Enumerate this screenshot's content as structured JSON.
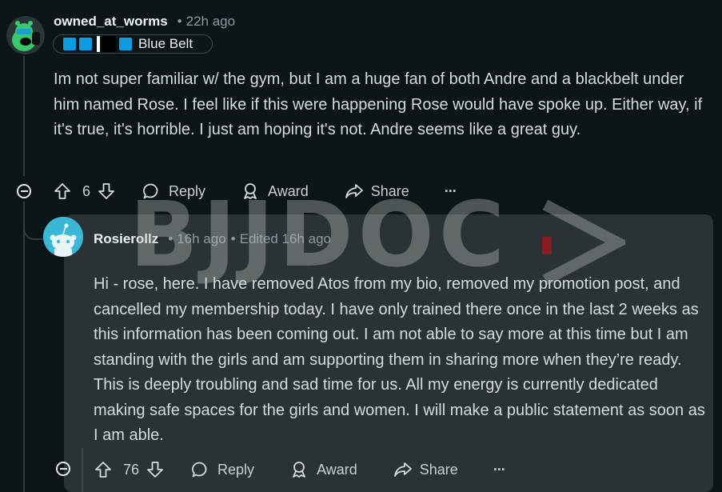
{
  "comment1": {
    "username": "owned_at_worms",
    "time": "22h ago",
    "flair": "Blue Belt",
    "body": "Im not super familiar w/ the gym, but I am a huge fan of both Andre and a blackbelt under him named Rose. I feel like if this were happening Rose would have spoke up. Either way, if it's true, it's horrible. I just am hoping it's not. Andre seems like a great guy.",
    "votes": "6",
    "reply_label": "Reply",
    "award_label": "Award",
    "share_label": "Share",
    "more_label": "···"
  },
  "comment2": {
    "username": "Rosierollz",
    "time": "16h ago",
    "edited": "Edited 16h ago",
    "body": "Hi - rose, here. I have removed Atos from my bio, removed my promotion post, and cancelled my membership today. I have only trained there once in the last 2 weeks as this information has been coming out. I am not able to say more at this time but I am standing with the girls and am supporting them in sharing more when they’re ready. This is deeply troubling and sad time for us. All my energy is currently dedicated making safe spaces for the girls and women. I will make a public statement as soon as I am able.",
    "votes": "76",
    "reply_label": "Reply",
    "award_label": "Award",
    "share_label": "Share",
    "more_label": "···"
  },
  "watermark": "BJJDOC",
  "colors": {
    "background": "#0b1416",
    "reply_card": "#2a3236",
    "flair_blue": "#0e9be2",
    "avatar_green": "#37c96b",
    "avatar_teal": "#3ab7d6"
  }
}
